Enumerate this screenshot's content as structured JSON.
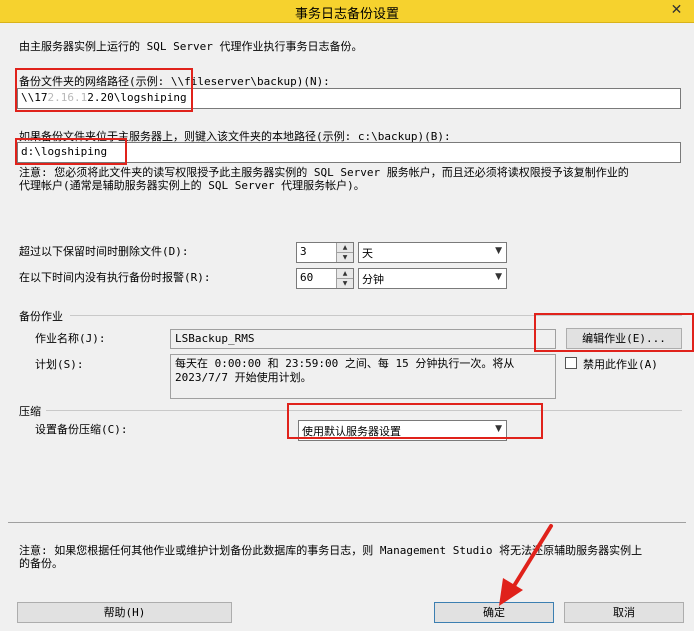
{
  "window": {
    "title": "事务日志备份设置",
    "close_glyph": "✕"
  },
  "intro": "由主服务器实例上运行的 SQL Server 代理作业执行事务日志备份。",
  "network_path": {
    "label": "备份文件夹的网络路径(示例: \\\\fileserver\\backup)(N):",
    "value_prefix": "\\\\17",
    "value_blurred": "2.16.1",
    "value_suffix": "2.20\\logshiping"
  },
  "local_path": {
    "label": "如果备份文件夹位于主服务器上，则键入该文件夹的本地路径(示例: c:\\backup)(B):",
    "value": "d:\\logshiping"
  },
  "note_top": {
    "line1": "注意: 您必须将此文件夹的读写权限授予此主服务器实例的 SQL Server 服务帐户，而且还必须将读权限授予该复制作业的",
    "line2": "代理帐户(通常是辅助服务器实例上的 SQL Server 代理服务帐户)。"
  },
  "delete_files": {
    "label": "超过以下保留时间时删除文件(D):",
    "value": "3",
    "unit": "天"
  },
  "alert": {
    "label": "在以下时间内没有执行备份时报警(R):",
    "value": "60",
    "unit": "分钟"
  },
  "backup_job": {
    "section": "备份作业",
    "name_label": "作业名称(J):",
    "name_value": "LSBackup_RMS",
    "edit_button": "编辑作业(E)...",
    "schedule_label": "计划(S):",
    "schedule_line1": "每天在 0:00:00 和 23:59:00 之间、每 15 分钟执行一次。将从",
    "schedule_line2": "2023/7/7 开始使用计划。",
    "disable_label": "禁用此作业(A)",
    "disable_checked": false
  },
  "compression": {
    "section": "压缩",
    "label": "设置备份压缩(C):",
    "value": "使用默认服务器设置"
  },
  "note_bottom": {
    "line1": "注意: 如果您根据任何其他作业或维护计划备份此数据库的事务日志，则 Management Studio 将无法还原辅助服务器实例上",
    "line2": "的备份。"
  },
  "buttons": {
    "help": "帮助(H)",
    "ok": "确定",
    "cancel": "取消"
  },
  "colors": {
    "title_bar": "#f6d22e",
    "highlight_box": "#e0221b",
    "arrow": "#e0221b"
  }
}
